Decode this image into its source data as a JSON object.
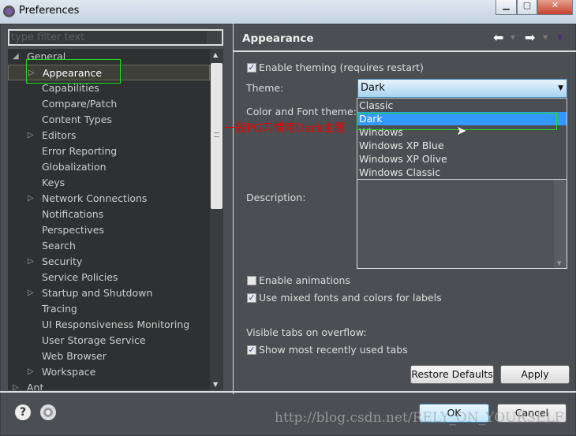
{
  "window": {
    "title": "Preferences",
    "controls": [
      "minimize",
      "maximize",
      "close"
    ]
  },
  "filter": {
    "placeholder": "type filter text"
  },
  "tree": {
    "items": [
      {
        "label": "General",
        "level": 0,
        "expanded": true
      },
      {
        "label": "Appearance",
        "level": 1,
        "expandable": true,
        "selected": true
      },
      {
        "label": "Capabilities",
        "level": 1
      },
      {
        "label": "Compare/Patch",
        "level": 1
      },
      {
        "label": "Content Types",
        "level": 1
      },
      {
        "label": "Editors",
        "level": 1,
        "expandable": true
      },
      {
        "label": "Error Reporting",
        "level": 1
      },
      {
        "label": "Globalization",
        "level": 1
      },
      {
        "label": "Keys",
        "level": 1
      },
      {
        "label": "Network Connections",
        "level": 1,
        "expandable": true
      },
      {
        "label": "Notifications",
        "level": 1
      },
      {
        "label": "Perspectives",
        "level": 1
      },
      {
        "label": "Search",
        "level": 1
      },
      {
        "label": "Security",
        "level": 1,
        "expandable": true
      },
      {
        "label": "Service Policies",
        "level": 1
      },
      {
        "label": "Startup and Shutdown",
        "level": 1,
        "expandable": true
      },
      {
        "label": "Tracing",
        "level": 1
      },
      {
        "label": "UI Responsiveness Monitoring",
        "level": 1
      },
      {
        "label": "User Storage Service",
        "level": 1
      },
      {
        "label": "Web Browser",
        "level": 1
      },
      {
        "label": "Workspace",
        "level": 1,
        "expandable": true
      },
      {
        "label": "Ant",
        "level": 0,
        "expandable": true
      }
    ]
  },
  "page": {
    "title": "Appearance",
    "enable_theming": {
      "label": "Enable theming (requires restart)",
      "checked": true
    },
    "theme_label": "Theme:",
    "theme_value": "Dark",
    "theme_options": [
      "Classic",
      "Dark",
      "Windows",
      "Windows XP Blue",
      "Windows XP Olive",
      "Windows Classic"
    ],
    "highlighted_option": "Dark",
    "color_font_label": "Color and Font theme:",
    "description_label": "Description:",
    "enable_animations": {
      "label": "Enable animations",
      "checked": false
    },
    "mixed_fonts": {
      "label": "Use mixed fonts and colors for labels",
      "checked": true
    },
    "visible_tabs_label": "Visible tabs on overflow:",
    "recent_tabs": {
      "label": "Show most recently used tabs",
      "checked": true
    },
    "restore_defaults": "Restore Defaults",
    "apply": "Apply"
  },
  "footer": {
    "ok": "OK",
    "cancel": "Cancel"
  },
  "annotation": "一般PG习惯用Dark主题",
  "watermark": "http://blog.csdn.net/RELY_ON_YOURSELF",
  "colors": {
    "highlight": "#3399ff",
    "annotation": "#ee0000",
    "annotation_box": "#22dd22"
  }
}
